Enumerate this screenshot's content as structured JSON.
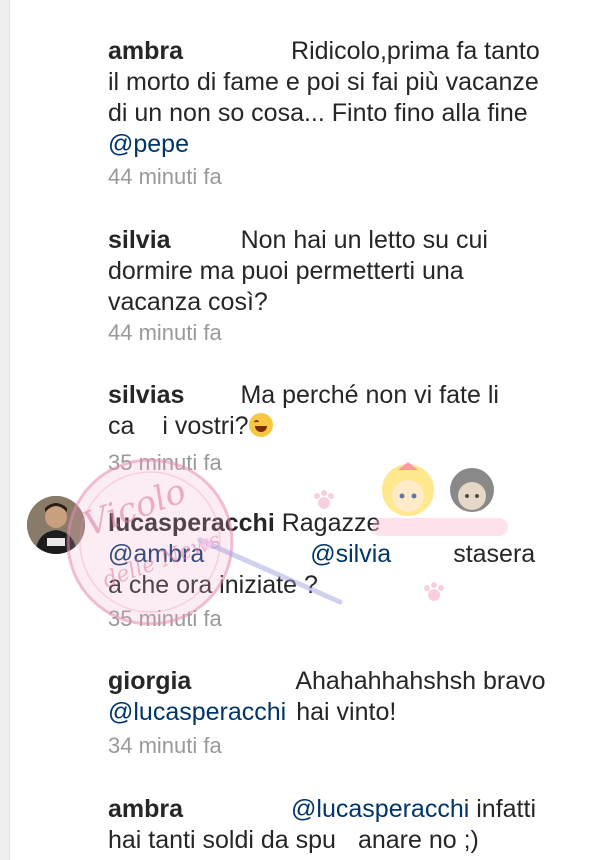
{
  "comments": [
    {
      "username": "ambra",
      "lines": [
        "Ridicolo,prima fa tanto",
        "il morto di fame e poi si fai più vacanze",
        "di un non so cosa... Finto fino alla fine"
      ],
      "mention": "@pepe",
      "time": "44 minuti fa"
    },
    {
      "username": "silvia",
      "lines": [
        "Non hai un letto su cui",
        "dormire ma puoi permetterti una",
        "vacanza così?"
      ],
      "time": "44 minuti fa"
    },
    {
      "username": "silvias",
      "line1": "Ma perché non vi fate li",
      "line2a": "ca",
      "line2b": "i vostri?",
      "emoji": "laughing-emoji",
      "time": "35 minuti fa"
    },
    {
      "username": "lucasperacchi",
      "text1": "Ragazze",
      "mention1": "@ambra",
      "mention2": "@silvia",
      "text2": "stasera",
      "line3": "a che ora iniziate ?",
      "time": "35 minuti fa"
    },
    {
      "username": "giorgia",
      "text1": "Ahahahhahshsh bravo",
      "mention": "@lucasperacchi",
      "text2": "hai vinto!",
      "time": "34 minuti fa"
    },
    {
      "username": "ambra",
      "mention": "@lucasperacchi",
      "text1": "infatti",
      "line2a": "hai tanti soldi da spu",
      "line2b": "anare no ;)"
    }
  ],
  "watermark": {
    "text1": "Vicolo",
    "text2": "delle News"
  },
  "colors": {
    "mention": "#003569",
    "time": "#999999",
    "text": "#262626"
  }
}
